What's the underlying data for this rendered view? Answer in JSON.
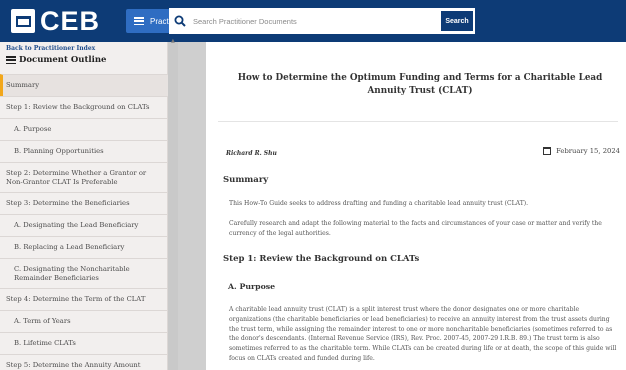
{
  "header": {
    "logo_text": "CEB",
    "practitioner_label": "Practitioner",
    "search_placeholder": "Search Practitioner Documents",
    "search_button": "Search"
  },
  "sidebar": {
    "back_link": "Back to Practitioner Index",
    "outline_title": "Document Outline",
    "items": [
      {
        "label": "Summary",
        "active": true
      },
      {
        "label": "Step 1: Review the Background on CLATs"
      },
      {
        "label": "A. Purpose"
      },
      {
        "label": "B. Planning Opportunities"
      },
      {
        "label": "Step 2: Determine Whether a Grantor or Non-Grantor CLAT Is Preferable"
      },
      {
        "label": "Step 3: Determine the Beneficiaries"
      },
      {
        "label": "A. Designating the Lead Beneficiary"
      },
      {
        "label": "B. Replacing a Lead Beneficiary"
      },
      {
        "label": "C. Designating the Noncharitable Remainder Beneficiaries"
      },
      {
        "label": "Step 4: Determine the Term of the CLAT"
      },
      {
        "label": "A. Term of Years"
      },
      {
        "label": "B. Lifetime CLATs"
      },
      {
        "label": "Step 5: Determine the Annuity Amount"
      }
    ]
  },
  "document": {
    "title": "How to Determine the Optimum Funding and Terms for a Charitable Lead Annuity Trust (CLAT)",
    "author": "Richard R. Shu",
    "date": "February 15, 2024",
    "summary_heading": "Summary",
    "summary_p1": "This How-To Guide seeks to address drafting and funding a charitable lead annuity trust (CLAT).",
    "summary_p2": "Carefully research and adapt the following material to the facts and circumstances of your case or matter and verify the currency of the legal authorities.",
    "step1_heading": "Step 1: Review the Background on CLATs",
    "purpose_heading": "A. Purpose",
    "purpose_p": "A charitable lead annuity trust (CLAT) is a split interest trust where the donor designates one or more charitable organizations (the charitable beneficiaries or lead beneficiaries) to receive an annuity interest from the trust assets during the trust term, while assigning the remainder interest to one or more noncharitable beneficiaries (sometimes referred to as the donor's descendants. (Internal Revenue Service (IRS), Rev. Proc. 2007-45, 2007-29 I.R.B. 89.) The trust term is also sometimes referred to as the charitable term. While CLATs can be created during life or at death, the scope of this guide will focus on CLATs created and funded during life."
  }
}
